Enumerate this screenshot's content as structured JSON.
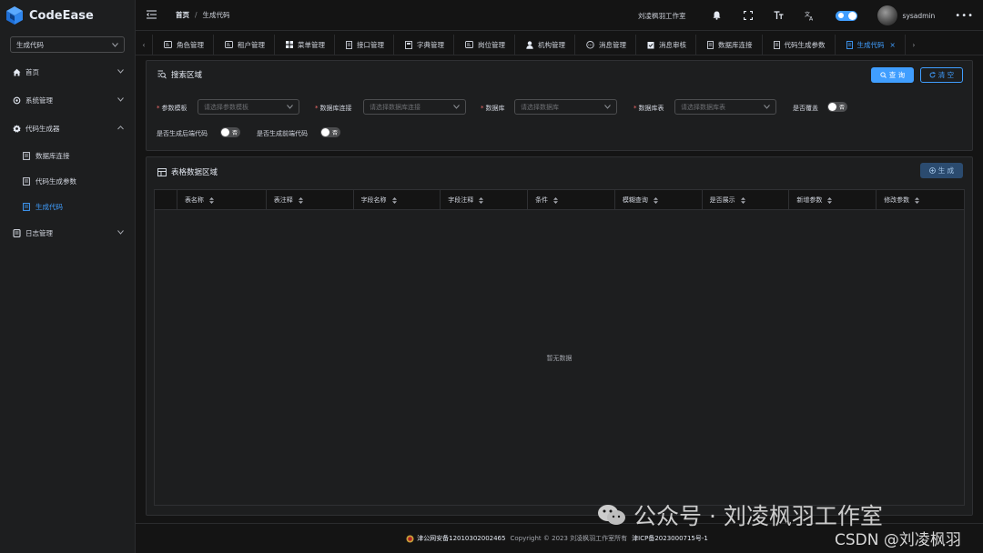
{
  "app": {
    "name": "CodeEase",
    "accent": "#409eff"
  },
  "sidebar": {
    "select_value": "生成代码",
    "items": [
      {
        "label": "首页",
        "icon": "home-icon"
      },
      {
        "label": "系统管理",
        "icon": "gear-icon"
      },
      {
        "label": "代码生成器",
        "icon": "gear-icon",
        "expanded": true,
        "children": [
          {
            "label": "数据库连接",
            "icon": "document-icon"
          },
          {
            "label": "代码生成参数",
            "icon": "document-icon"
          },
          {
            "label": "生成代码",
            "icon": "document-icon",
            "active": true
          }
        ]
      },
      {
        "label": "日志管理",
        "icon": "document-icon"
      }
    ]
  },
  "header": {
    "breadcrumb_home": "首页",
    "breadcrumb_sep": "/",
    "breadcrumb_current": "生成代码",
    "studio": "刘凌枫羽工作室",
    "username": "sysadmin",
    "more": "•••"
  },
  "tabs": [
    {
      "label": "角色管理",
      "icon": "role-icon"
    },
    {
      "label": "租户管理",
      "icon": "tenant-icon"
    },
    {
      "label": "菜单管理",
      "icon": "grid-icon"
    },
    {
      "label": "接口管理",
      "icon": "doc-icon"
    },
    {
      "label": "字典管理",
      "icon": "book-icon"
    },
    {
      "label": "岗位管理",
      "icon": "role-icon"
    },
    {
      "label": "机构管理",
      "icon": "user-icon"
    },
    {
      "label": "消息管理",
      "icon": "chat-icon"
    },
    {
      "label": "消息审核",
      "icon": "audit-icon"
    },
    {
      "label": "数据库连接",
      "icon": "doc-icon"
    },
    {
      "label": "代码生成参数",
      "icon": "doc-icon"
    },
    {
      "label": "生成代码",
      "icon": "doc-icon",
      "active": true,
      "close": "×"
    }
  ],
  "search": {
    "title": "搜索区域",
    "query_button": "查 询",
    "reset_button": "清 空",
    "fields": {
      "template": {
        "label": "参数模板",
        "placeholder": "请选择参数模板"
      },
      "connection": {
        "label": "数据库连接",
        "placeholder": "请选择数据库连接"
      },
      "database": {
        "label": "数据库",
        "placeholder": "请选择数据库"
      },
      "table": {
        "label": "数据库表",
        "placeholder": "请选择数据库表"
      },
      "overwrite": {
        "label": "是否覆盖",
        "value": "否"
      },
      "backend": {
        "label": "是否生成后端代码",
        "value": "否"
      },
      "frontend": {
        "label": "是否生成前端代码",
        "value": "否"
      }
    }
  },
  "table_area": {
    "title": "表格数据区域",
    "generate_button": "生 成",
    "columns": [
      "表名称",
      "表注释",
      "字段名称",
      "字段注释",
      "条件",
      "模糊查询",
      "是否展示",
      "新增参数",
      "修改参数"
    ],
    "empty_text": "暂无数据"
  },
  "footer": {
    "police": "津公网安备12010302002465",
    "copyright": "Copyright © 2023 刘凌枫羽工作室所有",
    "icp": "津ICP备2023000715号-1"
  },
  "watermark": {
    "wechat": "公众号 · 刘凌枫羽工作室",
    "csdn": "CSDN @刘凌枫羽"
  }
}
